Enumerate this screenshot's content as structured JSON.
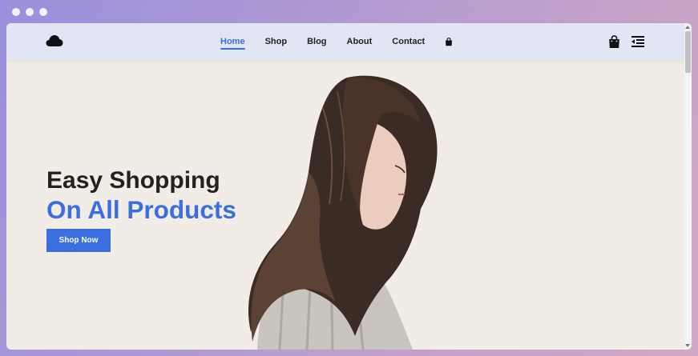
{
  "nav": {
    "links": [
      {
        "label": "Home",
        "active": true
      },
      {
        "label": "Shop",
        "active": false
      },
      {
        "label": "Blog",
        "active": false
      },
      {
        "label": "About",
        "active": false
      },
      {
        "label": "Contact",
        "active": false
      }
    ],
    "icons": [
      "cloud-logo-icon",
      "shopping-bag-icon",
      "menu-indent-icon"
    ]
  },
  "hero": {
    "line1": "Easy Shopping",
    "line2": "On All Products",
    "button_label": "Shop Now"
  },
  "colors": {
    "accent": "#3b6fe0",
    "navbar_bg": "#e2e5f3",
    "hero_bg": "#f1ece6",
    "heading": "#222222"
  }
}
